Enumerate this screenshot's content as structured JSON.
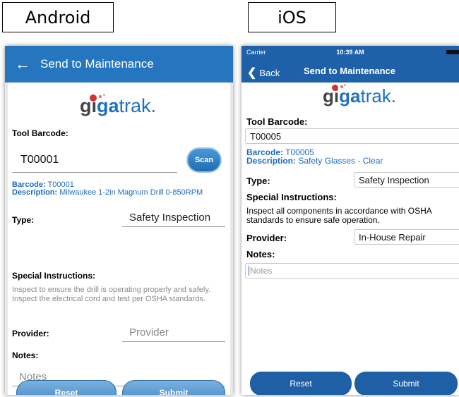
{
  "labels": {
    "android": "Android",
    "ios": "iOS"
  },
  "brand": {
    "part1": "gi",
    "part2": "ga",
    "part3": "trak."
  },
  "android": {
    "back_icon": "arrow-left-icon",
    "title": "Send to Maintenance",
    "tool_barcode_label": "Tool Barcode:",
    "tool_barcode_value": "T00001",
    "scan_label": "Scan",
    "barcode_prefix": "Barcode:",
    "barcode_value": "T00001",
    "description_prefix": "Description:",
    "description_value": "Milwaukee 1-2in Magnum Drill 0-850RPM",
    "type_label": "Type:",
    "type_value": "Safety Inspection",
    "special_label": "Special Instructions:",
    "special_text": "Inspect to ensure the drill is operating properly and safely.  Inspect the electrical cord and test per OSHA standards.",
    "provider_label": "Provider:",
    "provider_placeholder": "Provider",
    "notes_label": "Notes:",
    "notes_placeholder": "Notes",
    "reset_label": "Reset",
    "submit_label": "Submit"
  },
  "ios": {
    "carrier": "Carrier",
    "time": "10:39 AM",
    "back_label": "Back",
    "title": "Send to Maintenance",
    "tool_barcode_label": "Tool Barcode:",
    "tool_barcode_value": "T00005",
    "barcode_prefix": "Barcode:",
    "barcode_value": "T00005",
    "description_prefix": "Description:",
    "description_value": "Safety Glasses - Clear",
    "type_label": "Type:",
    "type_value": "Safety Inspection",
    "special_label": "Special Instructions:",
    "special_text": "Inspect all components in accordance with OSHA standards to ensure safe operation.",
    "provider_label": "Provider:",
    "provider_value": "In-House Repair",
    "notes_label": "Notes:",
    "notes_placeholder": "Notes",
    "reset_label": "Reset",
    "submit_label": "Submit"
  },
  "colors": {
    "appbar": "#2676bf",
    "ios_nav": "#1f61a8",
    "link_blue": "#1d6cbf"
  }
}
